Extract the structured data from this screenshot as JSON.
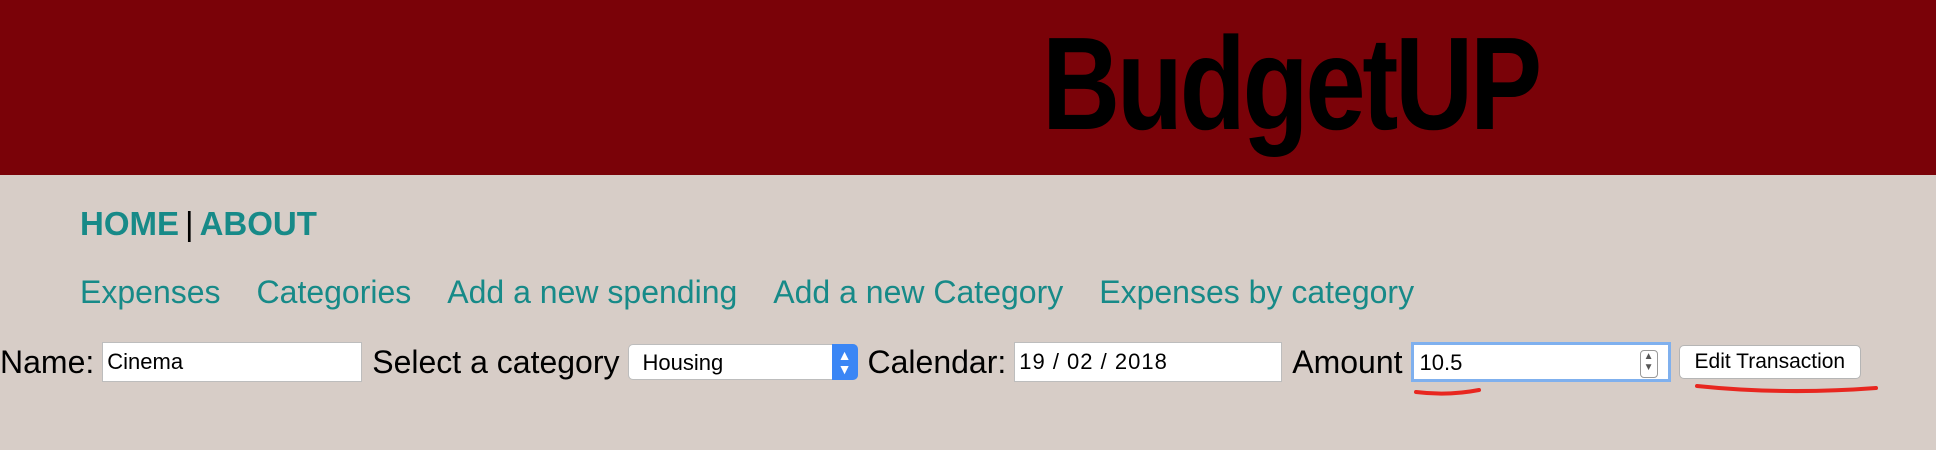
{
  "header": {
    "brand": "BudgetUP"
  },
  "topnav": {
    "home": "HOME",
    "separator": "|",
    "about": "ABOUT"
  },
  "subnav": {
    "items": [
      "Expenses",
      "Categories",
      "Add a new spending",
      "Add a new Category",
      "Expenses by category"
    ]
  },
  "form": {
    "name_label": "Name:",
    "name_value": "Cinema",
    "category_label": "Select a category",
    "category_value": "Housing",
    "calendar_label": "Calendar:",
    "calendar_value": "19 / 02 / 2018",
    "amount_label": "Amount",
    "amount_value": "10.5",
    "submit_label": "Edit Transaction"
  },
  "colors": {
    "header_bg": "#7a0208",
    "page_bg": "#d7cdc7",
    "link": "#178a88",
    "annotation": "#e8261f",
    "focus_ring": "#7fb0ee"
  }
}
